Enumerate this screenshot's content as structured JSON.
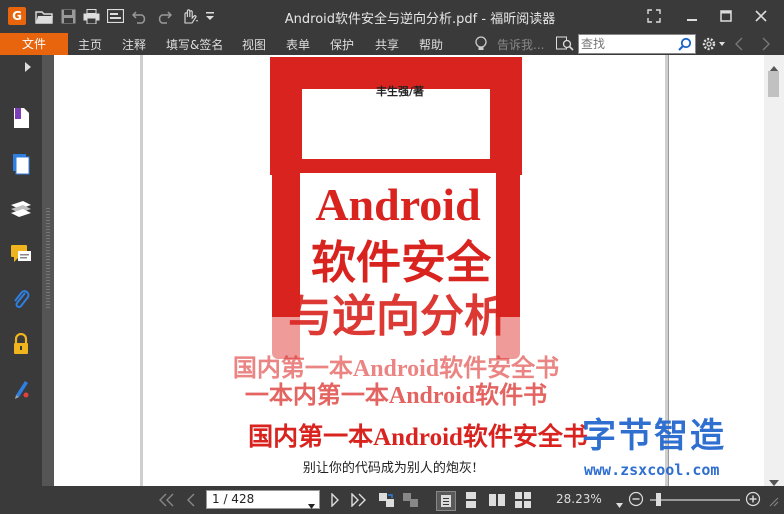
{
  "window": {
    "title": "Android软件安全与逆向分析.pdf - 福昕阅读器",
    "app_logo": "G"
  },
  "menu": {
    "file_label": "文件",
    "items": [
      "主页",
      "注释",
      "填写&签名",
      "视图",
      "表单",
      "保护",
      "共享",
      "帮助"
    ],
    "tell_me": "告诉我...",
    "search_placeholder": "查找"
  },
  "document": {
    "author": "丰生强/著",
    "title_en": "Android",
    "title_cn_line1": "软件安全",
    "title_cn_line2": "与逆向分析",
    "blurb_line1": "国内第一本Android软件安全书",
    "blurb_line2": "一本内第一本Android软件书",
    "tagline": "国内第一本Android软件安全书",
    "slogan": "别让你的代码成为别人的炮灰!",
    "brand_color": "#d9231f"
  },
  "watermark": {
    "text_cn": "字节智造",
    "url": "www.zsxcool.com",
    "color": "#2f6fd0"
  },
  "status": {
    "page_display": "1 / 428",
    "zoom": "28.23%"
  },
  "colors": {
    "accent": "#e8650e",
    "chrome": "#3a3a3a"
  }
}
